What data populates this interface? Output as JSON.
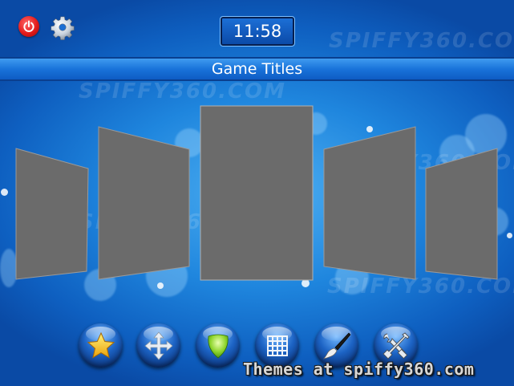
{
  "header": {
    "clock": "11:58",
    "power_icon": "power-icon",
    "settings_icon": "gear-icon",
    "title": "Game Titles"
  },
  "watermark": "SPIFFY360.COM",
  "covers": {
    "count": 5,
    "fill_color": "#6b6b6b",
    "border_color": "#9a9a9a",
    "selected_index": 2
  },
  "dock": {
    "buttons": [
      {
        "name": "favorites-button",
        "icon": "star-icon"
      },
      {
        "name": "move-button",
        "icon": "move-arrows-icon"
      },
      {
        "name": "green-button",
        "icon": "green-shield-icon"
      },
      {
        "name": "grid-view-button",
        "icon": "grid-icon"
      },
      {
        "name": "themes-button",
        "icon": "paintbrush-icon"
      },
      {
        "name": "tools-button",
        "icon": "tools-icon"
      }
    ]
  },
  "footer": {
    "text": "Themes at spiffy360.com"
  },
  "colors": {
    "background": "#1f86de",
    "accent": "#0e5cc4",
    "power": "#e31b1b"
  }
}
